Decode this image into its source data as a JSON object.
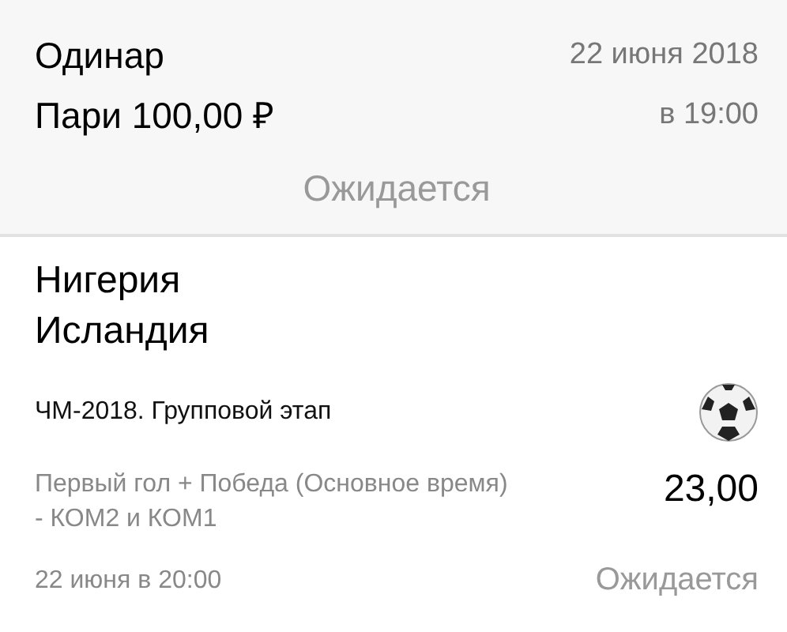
{
  "bet": {
    "type": "Одинар",
    "stake": "Пари 100,00 ₽",
    "date": "22 июня 2018",
    "time": "в 19:00",
    "status": "Ожидается"
  },
  "event": {
    "teams": [
      "Нигерия",
      "Исландия"
    ],
    "tournament": "ЧМ-2018. Групповой этап",
    "market": "Первый гол + Победа (Основное время) - КОМ2 и КОМ1",
    "odds": "23,00",
    "date": "22 июня в 20:00",
    "status": "Ожидается"
  }
}
